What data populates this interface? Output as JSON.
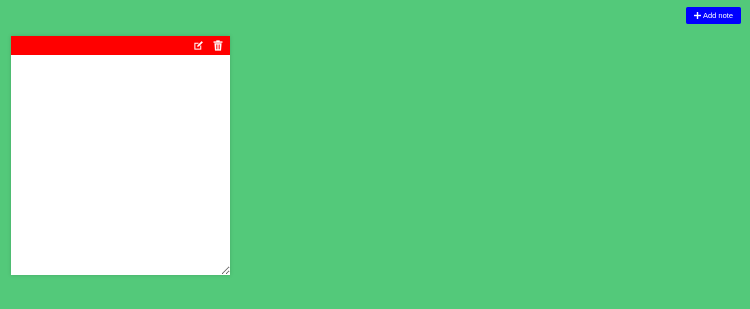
{
  "toolbar": {
    "add_note_label": "Add note",
    "add_note_icon": "plus-icon",
    "button_color": "#0000ff"
  },
  "notes": [
    {
      "header_color": "#ff0000",
      "edit_icon": "edit-icon",
      "delete_icon": "trash-icon",
      "text": ""
    }
  ],
  "colors": {
    "background": "#53c97a",
    "note_body": "#ffffff"
  }
}
